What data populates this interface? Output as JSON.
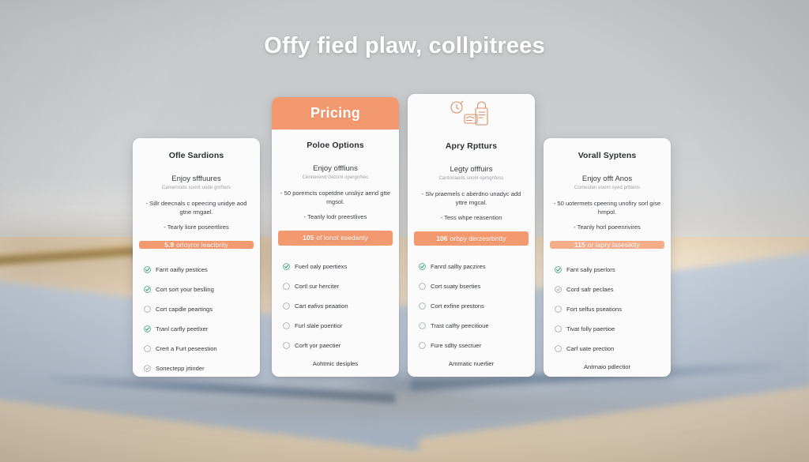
{
  "page": {
    "title": "Offy fied plaw, collpitrees"
  },
  "theme": {
    "accent": "#f2996f",
    "accent_light": "#f6b291",
    "check_green": "#2e9e6b",
    "circle_gray": "#9aa0a6",
    "card_bg": "#fbfbfb",
    "title_color": "#ffffff"
  },
  "cards": [
    {
      "id": "card-offers",
      "banner": null,
      "illustration": null,
      "title": "Ofle Sardions",
      "lead": "Enjoy sfffuures",
      "sub": "Camenrods soont uode gnrfters",
      "bullets": [
        "- Sillr deecnals c opeecing unidye aod gtne rmgael.",
        "- Tearly liore poseertlires"
      ],
      "price": {
        "amount": "5.9",
        "label": "orloyror leaclbrity"
      },
      "features": [
        {
          "mark": "check",
          "text": "Farrt oaifiy pestices"
        },
        {
          "mark": "check",
          "text": "Cort sort your beslling"
        },
        {
          "mark": "circle",
          "text": "Cort capdle peartings"
        },
        {
          "mark": "check",
          "text": "Tranl carfly peetlxer"
        },
        {
          "mark": "circle",
          "text": "Crert a Furt peseestion"
        },
        {
          "mark": "dot-circle",
          "text": "Sonectepp jrtinder"
        }
      ],
      "footnote": null
    },
    {
      "id": "card-pricing",
      "banner": "Pricing",
      "illustration": null,
      "title": "Poloe Options",
      "lead": "Enjoy offfiuns",
      "sub": "Cennerend clezonl opergnNec",
      "bullets": [
        "- 50 poremcts copetdne unsliyz aend gtte rngsol.",
        "- Teanly lodr preestlives"
      ],
      "price": {
        "amount": "105",
        "label": "of lonot esedanty"
      },
      "features": [
        {
          "mark": "check",
          "text": "Fuerl oaly poertiexs"
        },
        {
          "mark": "circle",
          "text": "Cortl sur herciter"
        },
        {
          "mark": "circle",
          "text": "Cart eafivs peaation"
        },
        {
          "mark": "circle",
          "text": "Furl slale poentior"
        },
        {
          "mark": "circle",
          "text": "Corft yor paectier"
        }
      ],
      "footnote": "Aohtmic desiples"
    },
    {
      "id": "card-apps",
      "banner": null,
      "illustration": "clock-bag-document-icon",
      "title": "Apry Rptturs",
      "lead": "Legty offfuirs",
      "sub": "Cantoriaeds snonl opmgnfess",
      "bullets": [
        "- Slv praemels c aberdno unadyc add yttre rngcal.",
        "- Tess whpe reasention"
      ],
      "price": {
        "amount": "106",
        "label": "orbpy derzesrbntty"
      },
      "features": [
        {
          "mark": "check",
          "text": "Fanrd sallty paczires"
        },
        {
          "mark": "circle",
          "text": "Cort suaty bserties"
        },
        {
          "mark": "circle",
          "text": "Cort exfine prestons"
        },
        {
          "mark": "circle",
          "text": "Trast calfty peecitioue"
        },
        {
          "mark": "circle",
          "text": "Fure sdlty ssectuer"
        }
      ],
      "footnote": "Ammatic nuerlier"
    },
    {
      "id": "card-systems",
      "banner": null,
      "illustration": null,
      "title": "Vorall Syptens",
      "lead": "Enjoy offt Anos",
      "sub": "Cornesten eoum oyed prttiens",
      "bullets": [
        "- 50 uotermets cpeering unofiry sorl gise hrnpol.",
        "- Teanly horl poeenrivires"
      ],
      "price": {
        "amount": "115",
        "label": "or lapry lasesiklty"
      },
      "features": [
        {
          "mark": "check",
          "text": "Fant sally pserlors"
        },
        {
          "mark": "dot-circle",
          "text": "Cord safr peclaes"
        },
        {
          "mark": "circle",
          "text": "Fort selfus pseations"
        },
        {
          "mark": "circle",
          "text": "Tivat folly paertioe"
        },
        {
          "mark": "circle",
          "text": "Carf uate prection"
        }
      ],
      "footnote": "Antrnaio pdlectior"
    }
  ]
}
